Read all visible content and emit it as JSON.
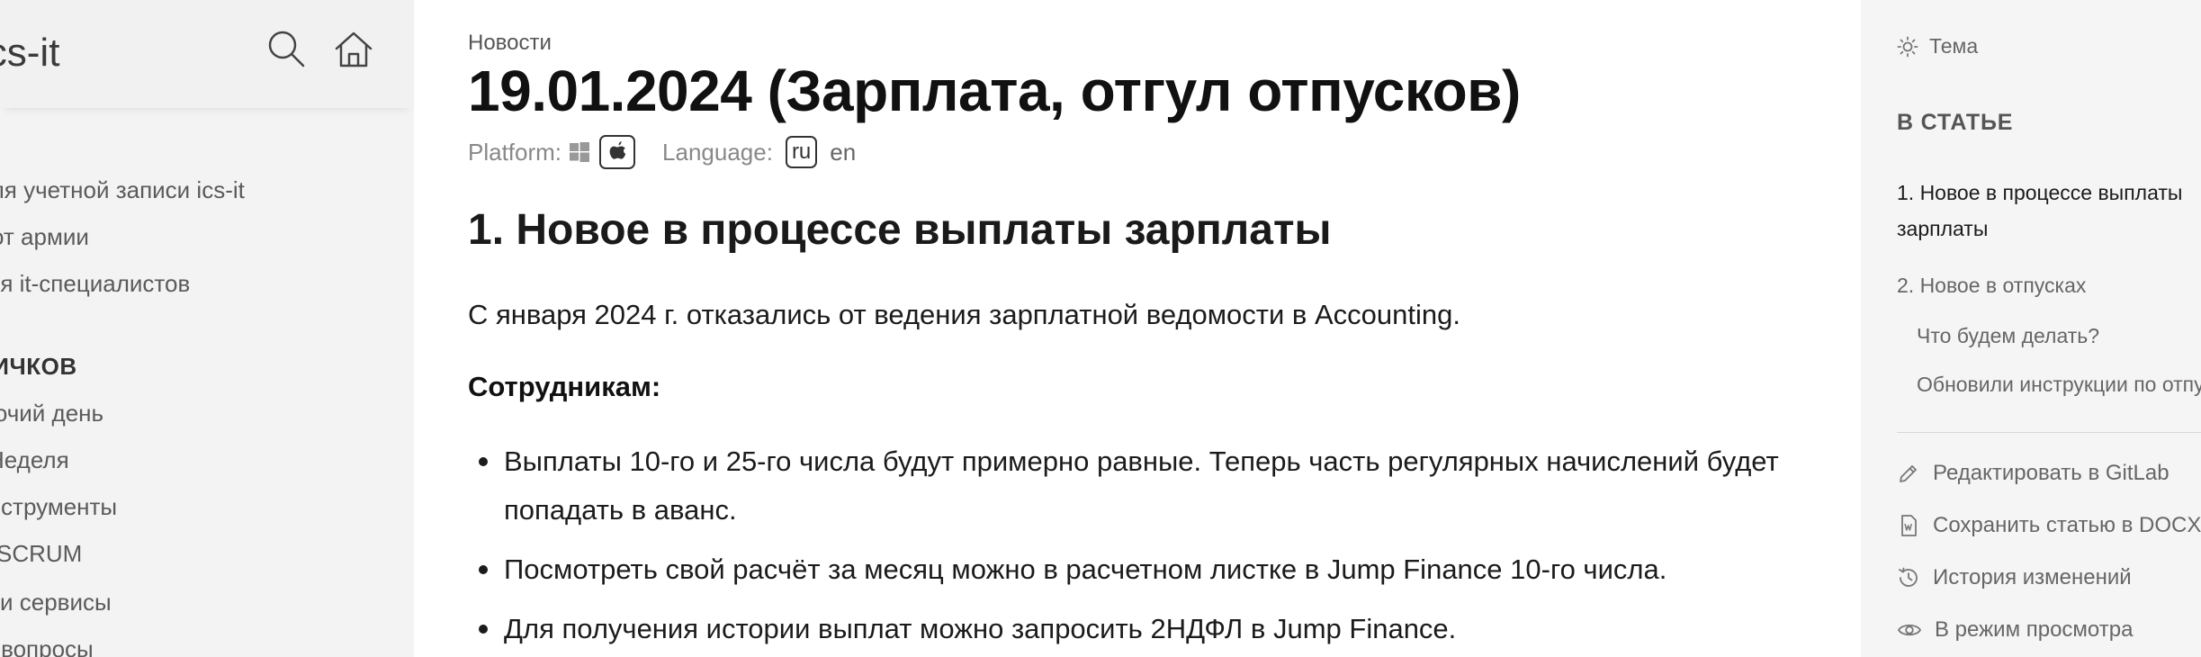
{
  "sidebar": {
    "logo": "ics-it",
    "links": [
      "Для учетной записи ics-it",
      "от армии",
      "для it-специалистов"
    ],
    "section_title": "НОВИЧКОВ",
    "section_links": [
      "Рабочий день",
      "Неделя",
      "Инструменты",
      "SCRUM",
      "и сервисы",
      "Частые вопросы"
    ]
  },
  "main": {
    "breadcrumb": "Новости",
    "title": "19.01.2024 (Зарплата, отгул отпусков)",
    "platform_label": "Platform:",
    "language_label": "Language:",
    "lang_ru": "ru",
    "lang_en": "en",
    "heading": "1. Новое в процессе выплаты зарплаты",
    "paragraph": "С января 2024 г. отказались от ведения зарплатной ведомости в Accounting.",
    "subheading": "Сотрудникам:",
    "bullets": [
      "Выплаты 10-го и 25-го числа будут примерно равные. Теперь часть регулярных начислений будет попадать в аванс.",
      "Посмотреть свой расчёт за месяц можно в расчетном листке в Jump Finance 10-го числа.",
      "Для получения истории выплат можно запросить 2НДФЛ в Jump Finance."
    ]
  },
  "rightbar": {
    "theme_label": "Тема",
    "toc_title": "В СТАТЬЕ",
    "toc": [
      "1. Новое в процессе выплаты зарплаты",
      "2. Новое в отпусках",
      "Что будем делать?",
      "Обновили инструкции по отпускам"
    ],
    "actions": [
      "Редактировать в GitLab",
      "Сохранить статью в DOCX",
      "История изменений",
      "В режим просмотра"
    ]
  }
}
